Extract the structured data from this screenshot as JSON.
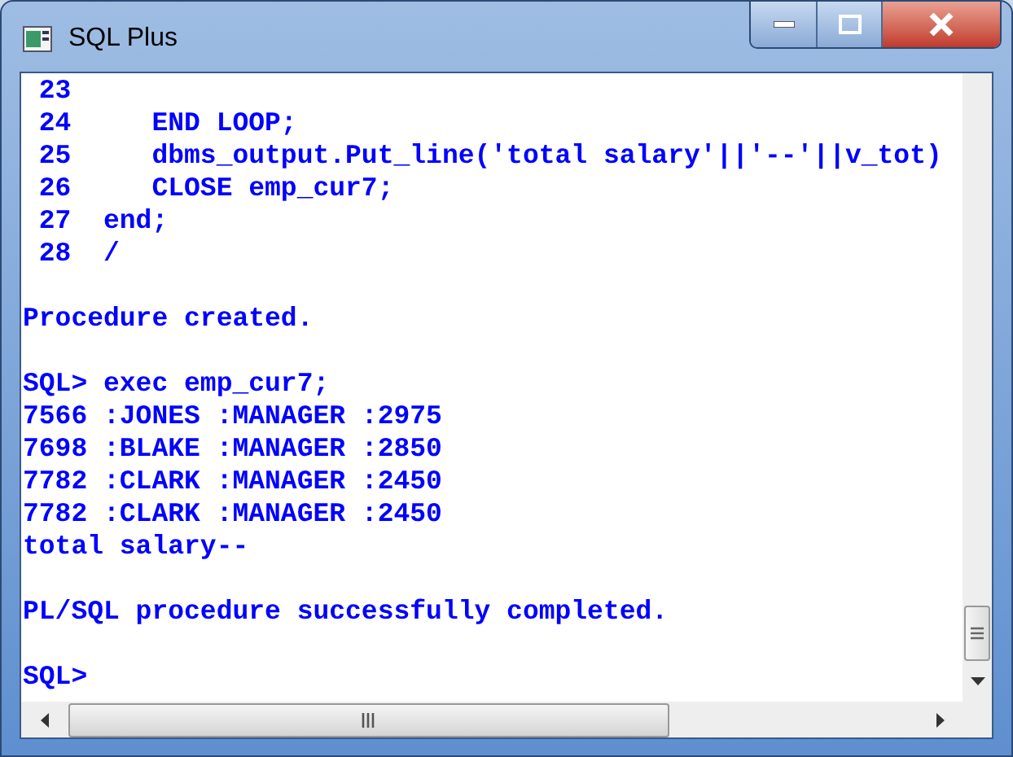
{
  "window": {
    "title": "SQL Plus"
  },
  "console": {
    "blocks": [
      [
        " 23",
        " 24     END LOOP;",
        " 25     dbms_output.Put_line('total salary'||'--'||v_tot)",
        " 26     CLOSE emp_cur7;",
        " 27  end;",
        " 28  /"
      ],
      [
        "Procedure created."
      ],
      [
        "SQL> exec emp_cur7;",
        "7566 :JONES :MANAGER :2975",
        "7698 :BLAKE :MANAGER :2850",
        "7782 :CLARK :MANAGER :2450",
        "7782 :CLARK :MANAGER :2450",
        "total salary--"
      ],
      [
        "PL/SQL procedure successfully completed."
      ],
      [
        "SQL>"
      ]
    ]
  }
}
